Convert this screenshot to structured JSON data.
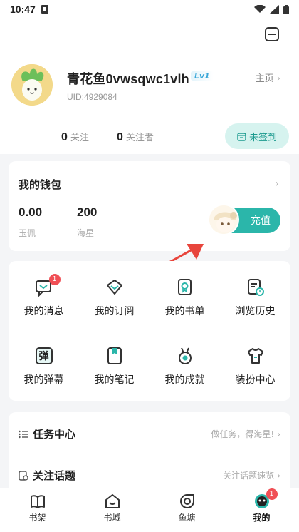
{
  "status": {
    "time": "10:47"
  },
  "profile": {
    "username": "青花鱼0vwsqwc1vlh",
    "level": "Lv1",
    "uid": "UID:4929084",
    "home_label": "主页",
    "following_count": "0",
    "following_label": "关注",
    "followers_count": "0",
    "followers_label": "关注者",
    "sign_label": "未签到"
  },
  "wallet": {
    "title": "我的钱包",
    "jade_value": "0.00",
    "jade_label": "玉佩",
    "star_value": "200",
    "star_label": "海星",
    "recharge_label": "充值"
  },
  "menu": {
    "items": [
      {
        "label": "我的消息",
        "icon": "message-icon",
        "badge": "1"
      },
      {
        "label": "我的订阅",
        "icon": "subscribe-icon"
      },
      {
        "label": "我的书单",
        "icon": "booklist-icon"
      },
      {
        "label": "浏览历史",
        "icon": "history-icon"
      },
      {
        "label": "我的弹幕",
        "icon": "danmaku-icon",
        "glyph": "弹"
      },
      {
        "label": "我的笔记",
        "icon": "notes-icon"
      },
      {
        "label": "我的成就",
        "icon": "medal-icon"
      },
      {
        "label": "装扮中心",
        "icon": "shirt-icon"
      }
    ]
  },
  "tasks": {
    "title": "任务中心",
    "subtitle": "做任务，得海星!",
    "topics_title": "关注话题",
    "topics_subtitle": "关注话题速览"
  },
  "tabbar": {
    "items": [
      {
        "label": "书架",
        "icon": "bookshelf-icon"
      },
      {
        "label": "书城",
        "icon": "bookstore-icon"
      },
      {
        "label": "鱼塘",
        "icon": "fishpond-icon"
      },
      {
        "label": "我的",
        "icon": "me-icon",
        "badge": "1",
        "active": true
      }
    ]
  },
  "colors": {
    "accent": "#2bb6aa",
    "accent_light": "#d6f3ef",
    "badge": "#f04f55",
    "arrow": "#e8453c"
  }
}
